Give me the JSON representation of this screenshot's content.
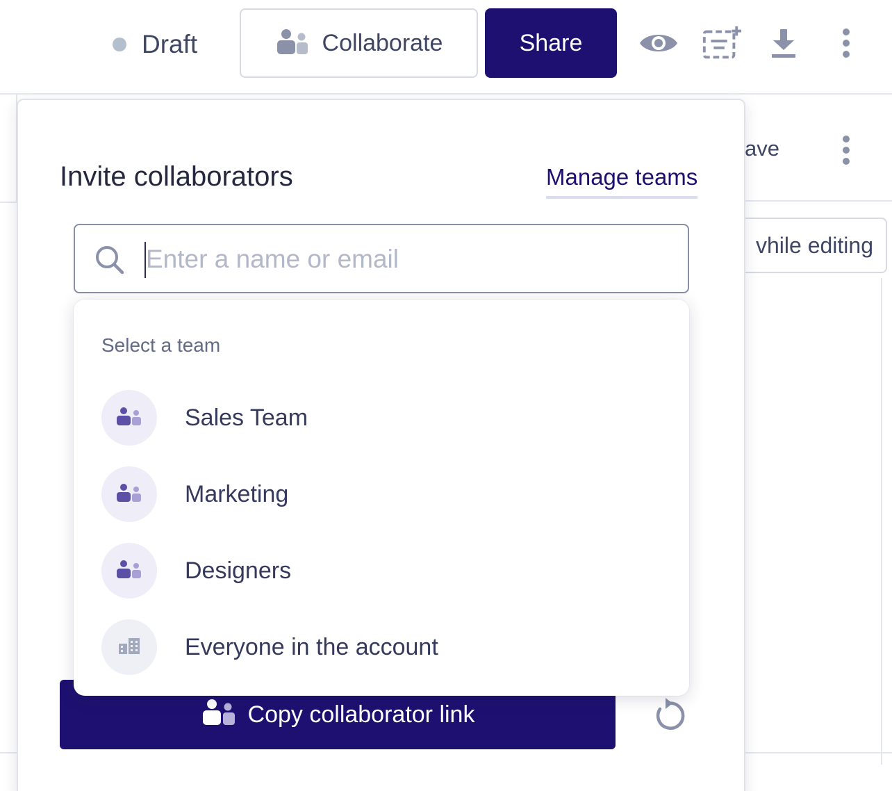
{
  "topbar": {
    "status": "Draft",
    "collaborate_label": "Collaborate",
    "share_label": "Share",
    "icons": [
      "people-icon",
      "eye-icon",
      "add-field-icon",
      "download-icon",
      "more-vertical-icon"
    ]
  },
  "background": {
    "save_partial": "ave",
    "editing_partial": "vhile editing"
  },
  "panel": {
    "title": "Invite collaborators",
    "manage_teams": "Manage teams",
    "search_placeholder": "Enter a name or email",
    "dropdown": {
      "heading": "Select a team",
      "teams": [
        {
          "name": "Sales Team",
          "icon": "team-icon"
        },
        {
          "name": "Marketing",
          "icon": "team-icon"
        },
        {
          "name": "Designers",
          "icon": "team-icon"
        },
        {
          "name": "Everyone in the account",
          "icon": "building-icon"
        }
      ]
    },
    "copy_link_label": "Copy collaborator link",
    "reset_icon": "reset-icon"
  },
  "colors": {
    "primary": "#1e1070",
    "status_dot": "#b3bfcc",
    "avatar_bg": "#eeedf8",
    "team_icon": "#5b4fa6"
  }
}
